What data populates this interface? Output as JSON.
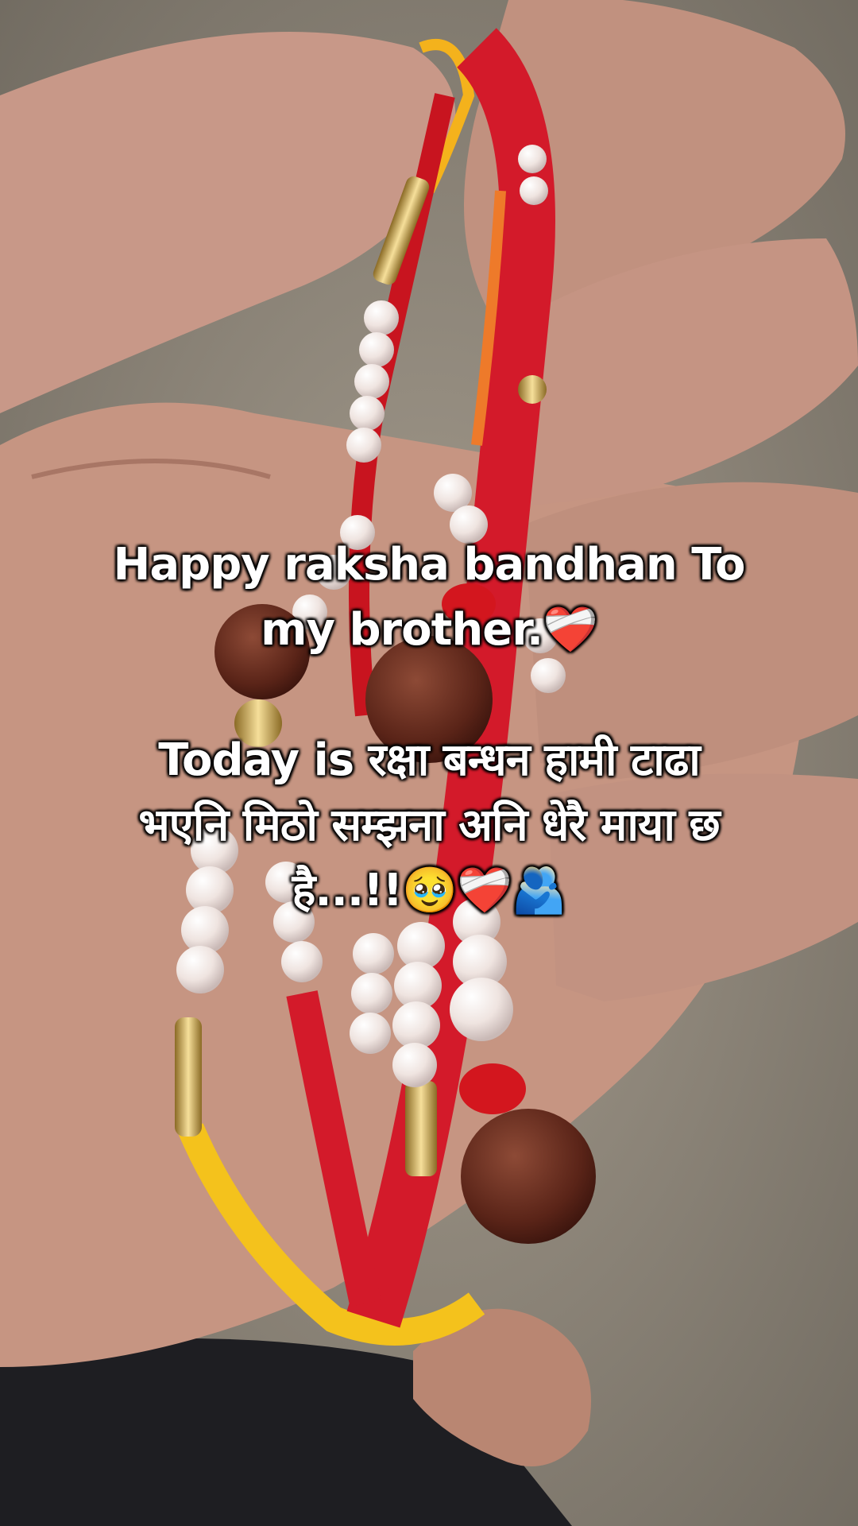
{
  "caption": {
    "line1": "Happy raksha bandhan To",
    "line2": "my brother.❤️‍🩹",
    "line3": "Today  is रक्षा बन्धन हामी टाढा",
    "line4": "भएनि मिठो सम्झना अनि धेरै माया छ",
    "line5": "है...!!🥹❤️‍🩹🫂"
  },
  "colors": {
    "thread_red": "#d31a2a",
    "thread_yellow": "#f4c21c",
    "pearl": "#f3ece8",
    "rudraksha": "#6b2f22",
    "skin": "#c99889",
    "text": "#ffffff"
  }
}
